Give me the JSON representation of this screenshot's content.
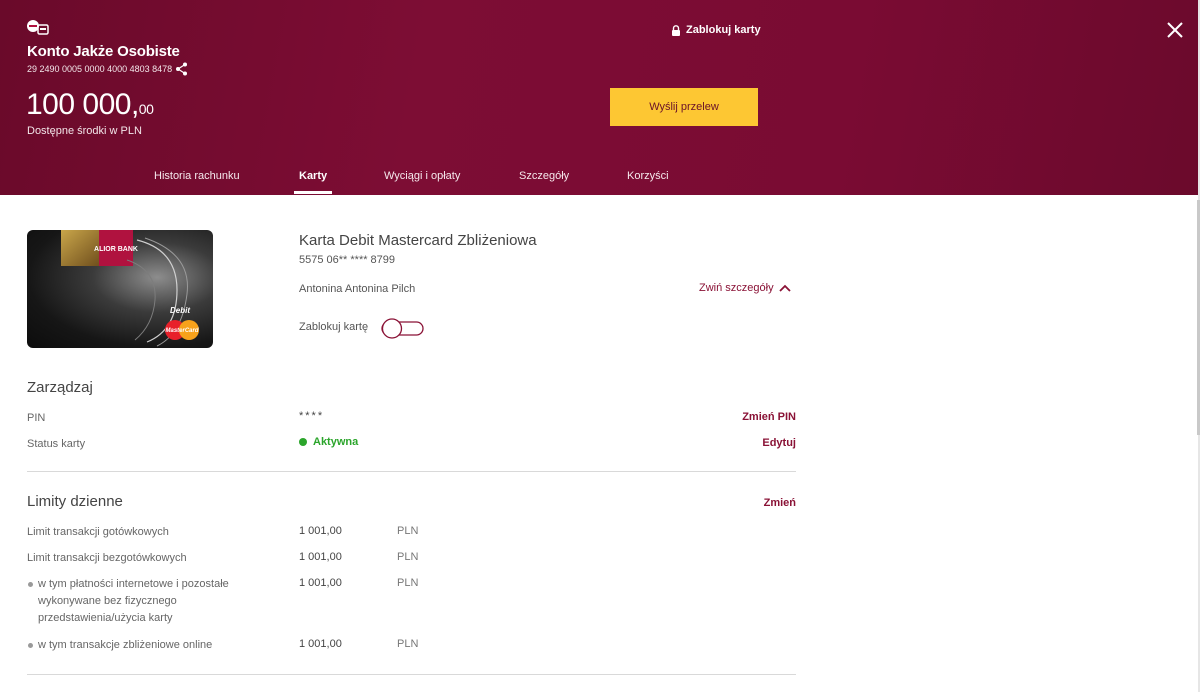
{
  "header": {
    "account_name": "Konto Jakże Osobiste",
    "account_number": "29 2490 0005 0000 4000 4803 8478",
    "balance_int": "100 000,",
    "balance_dec": "00",
    "balance_label": "Dostępne środki w PLN",
    "lock_cards_label": "Zablokuj karty",
    "send_transfer_label": "Wyślij przelew",
    "icons": {
      "logo": "bank-logo-icon",
      "share": "share-icon",
      "lock": "lock-icon",
      "close": "close-icon"
    }
  },
  "tabs": [
    {
      "label": "Historia rachunku",
      "active": false
    },
    {
      "label": "Karty",
      "active": true
    },
    {
      "label": "Wyciągi i opłaty",
      "active": false
    },
    {
      "label": "Szczegóły",
      "active": false
    },
    {
      "label": "Korzyści",
      "active": false
    }
  ],
  "card": {
    "image_text": {
      "bank": "ALIOR BANK",
      "type": "Debit",
      "brand": "MasterCard"
    },
    "title": "Karta Debit Mastercard Zbliżeniowa",
    "number": "5575 06** **** 8799",
    "holder": "Antonina Antonina Pilch",
    "collapse_label": "Zwiń szczegóły",
    "lock_card_label": "Zablokuj kartę",
    "lock_card_on": false
  },
  "manage": {
    "title": "Zarządzaj",
    "pin_label": "PIN",
    "pin_value": "****",
    "change_pin_label": "Zmień PIN",
    "status_label": "Status karty",
    "status_value": "Aktywna",
    "edit_label": "Edytuj"
  },
  "limits": {
    "title": "Limity dzienne",
    "change_label": "Zmień",
    "rows": [
      {
        "label": "Limit transakcji gotówkowych",
        "value": "1 001,00",
        "unit": "PLN"
      },
      {
        "label": "Limit transakcji bezgotówkowych",
        "value": "1 001,00",
        "unit": "PLN"
      },
      {
        "label": "w tym płatności internetowe i pozostałe wykonywane bez fizycznego przedstawienia/użycia karty",
        "value": "1 001,00",
        "unit": "PLN"
      },
      {
        "label": "w tym transakcje zbliżeniowe online",
        "value": "1 001,00",
        "unit": "PLN"
      }
    ]
  },
  "colors": {
    "brand": "#7a0b33",
    "accent_button": "#fdc733",
    "link": "#8a1236",
    "status_active": "#2ba52b"
  }
}
